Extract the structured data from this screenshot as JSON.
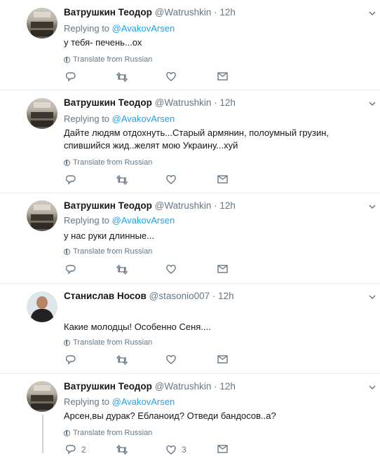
{
  "tweets": [
    {
      "name": "Ватрушкин Теодор",
      "handle": "@Watrushkin",
      "dot": "·",
      "time": "12h",
      "reply_prefix": "Replying to",
      "reply_to": "@AvakovArsen",
      "text": "у тебя- печень...ох",
      "translate": "Translate from Russian",
      "reply_count": "",
      "like_count": ""
    },
    {
      "name": "Ватрушкин Теодор",
      "handle": "@Watrushkin",
      "dot": "·",
      "time": "12h",
      "reply_prefix": "Replying to",
      "reply_to": "@AvakovArsen",
      "text": "Дайте людям отдохнуть...Старый армянин, полоумный грузин,  спившийся жид..желят мою Украину...хуй",
      "translate": "Translate from Russian",
      "reply_count": "",
      "like_count": ""
    },
    {
      "name": "Ватрушкин Теодор",
      "handle": "@Watrushkin",
      "dot": "·",
      "time": "12h",
      "reply_prefix": "Replying to",
      "reply_to": "@AvakovArsen",
      "text": "у нас руки длинные...",
      "translate": "Translate from Russian",
      "reply_count": "",
      "like_count": ""
    },
    {
      "name": "Станислав Носов",
      "handle": "@stasonio007",
      "dot": "·",
      "time": "12h",
      "reply_prefix": "",
      "reply_to": "",
      "text": "Какие молодцы! Особенно Сеня....",
      "translate": "Translate from Russian",
      "reply_count": "",
      "like_count": ""
    },
    {
      "name": "Ватрушкин Теодор",
      "handle": "@Watrushkin",
      "dot": "·",
      "time": "12h",
      "reply_prefix": "Replying to",
      "reply_to": "@AvakovArsen",
      "text": "Арсен,вы дурак? Ебланоид? Отведи бандосов..а?",
      "translate": "Translate from Russian",
      "reply_count": "2",
      "like_count": "3"
    }
  ],
  "icons": {
    "reply": "reply-icon",
    "retweet": "retweet-icon",
    "like": "heart-icon",
    "dm": "envelope-icon",
    "menu": "chevron-down-icon",
    "translate": "globe-icon"
  },
  "colors": {
    "accent": "#1da1f2",
    "muted": "#657786",
    "text": "#14171a",
    "divider": "#e6ecf0"
  }
}
